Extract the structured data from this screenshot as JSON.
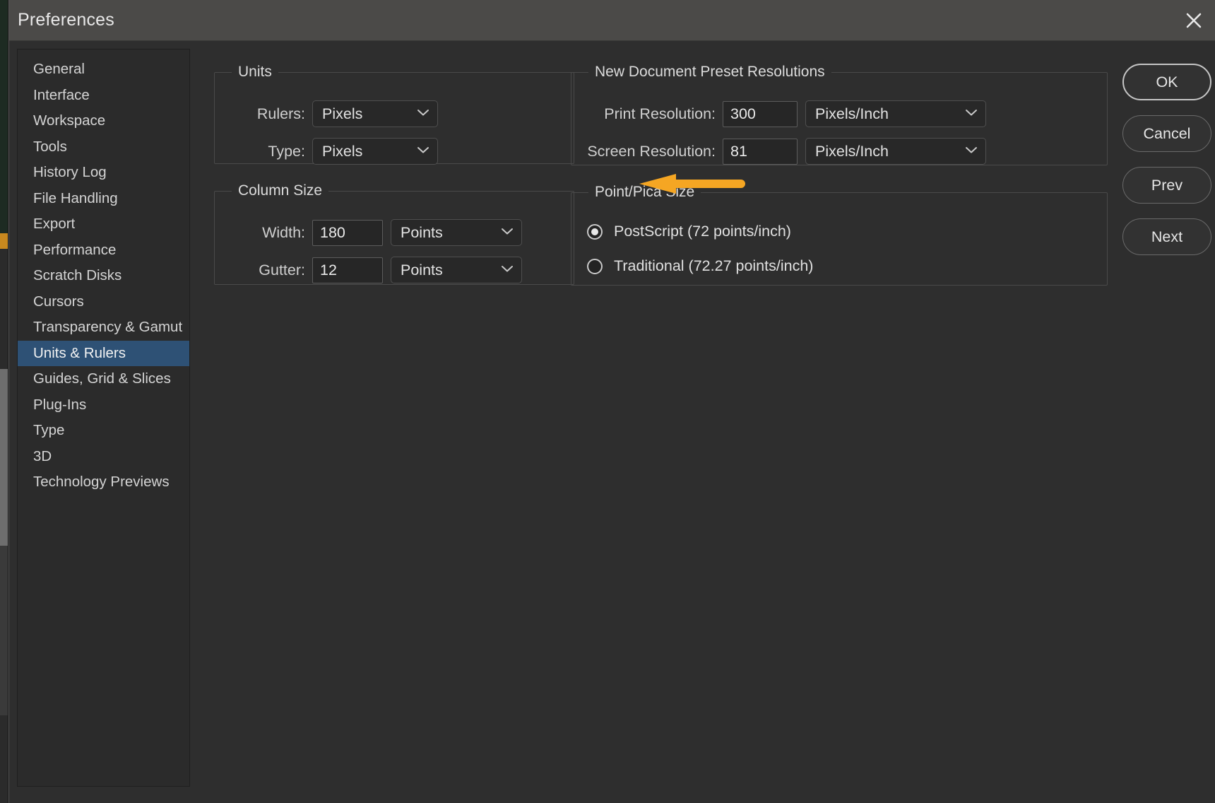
{
  "window": {
    "title": "Preferences",
    "close_icon": "close-icon"
  },
  "sidebar": {
    "items": [
      {
        "label": "General",
        "selected": false
      },
      {
        "label": "Interface",
        "selected": false
      },
      {
        "label": "Workspace",
        "selected": false
      },
      {
        "label": "Tools",
        "selected": false
      },
      {
        "label": "History Log",
        "selected": false
      },
      {
        "label": "File Handling",
        "selected": false
      },
      {
        "label": "Export",
        "selected": false
      },
      {
        "label": "Performance",
        "selected": false
      },
      {
        "label": "Scratch Disks",
        "selected": false
      },
      {
        "label": "Cursors",
        "selected": false
      },
      {
        "label": "Transparency & Gamut",
        "selected": false
      },
      {
        "label": "Units & Rulers",
        "selected": true
      },
      {
        "label": "Guides, Grid & Slices",
        "selected": false
      },
      {
        "label": "Plug-Ins",
        "selected": false
      },
      {
        "label": "Type",
        "selected": false
      },
      {
        "label": "3D",
        "selected": false
      },
      {
        "label": "Technology Previews",
        "selected": false
      }
    ]
  },
  "units_group": {
    "legend": "Units",
    "rulers_label": "Rulers:",
    "rulers_value": "Pixels",
    "type_label": "Type:",
    "type_value": "Pixels"
  },
  "column_group": {
    "legend": "Column Size",
    "width_label": "Width:",
    "width_value": "180",
    "width_unit": "Points",
    "gutter_label": "Gutter:",
    "gutter_value": "12",
    "gutter_unit": "Points"
  },
  "newdoc_group": {
    "legend": "New Document Preset Resolutions",
    "print_label": "Print Resolution:",
    "print_value": "300",
    "print_unit": "Pixels/Inch",
    "screen_label": "Screen Resolution:",
    "screen_value": "81",
    "screen_unit": "Pixels/Inch"
  },
  "pointpica_group": {
    "legend": "Point/Pica Size",
    "options": [
      {
        "label": "PostScript (72 points/inch)",
        "selected": true
      },
      {
        "label": "Traditional (72.27 points/inch)",
        "selected": false
      }
    ]
  },
  "buttons": {
    "ok": "OK",
    "cancel": "Cancel",
    "prev": "Prev",
    "next": "Next"
  },
  "annotation": {
    "arrow_icon": "arrow-left-icon",
    "arrow_color": "#F5A623",
    "points_at": "Type dropdown"
  },
  "colors": {
    "titlebar": "#4b4a48",
    "dialog_bg": "#2e2e2e",
    "sidebar_bg": "#2b2b2b",
    "selection": "#2e5175",
    "accent_orange": "#F5A623"
  }
}
